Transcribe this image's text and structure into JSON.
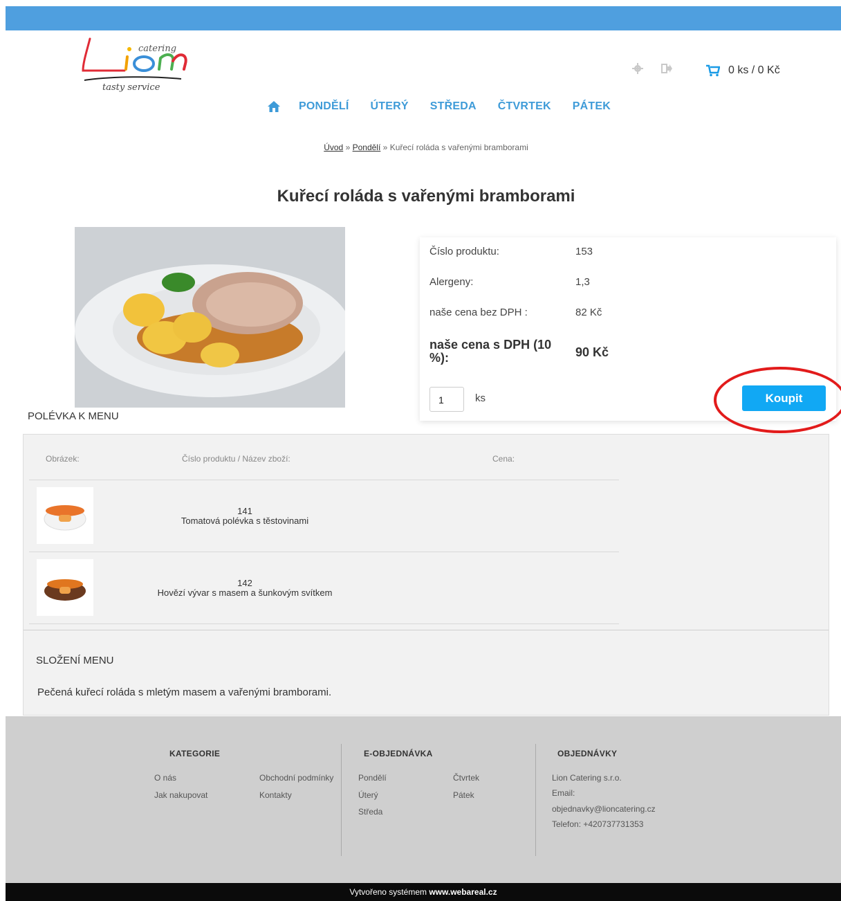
{
  "logo": {
    "small": "catering",
    "main": "Lion",
    "tagline": "tasty service"
  },
  "header": {
    "icons": [
      "gear-icon",
      "logout-icon",
      "cart-icon"
    ],
    "cart": "0 ks / 0 Kč"
  },
  "nav": {
    "items": [
      "PONDĚLÍ",
      "ÚTERÝ",
      "STŘEDA",
      "ČTVRTEK",
      "PÁTEK"
    ]
  },
  "breadcrumb": {
    "home": "Úvod",
    "sep": "»",
    "category": "Pondělí",
    "current": "Kuřecí roláda s vařenými bramborami"
  },
  "product": {
    "title": "Kuřecí roláda s vařenými bramborami",
    "rows": [
      {
        "label": "Číslo produktu:",
        "value": "153"
      },
      {
        "label": "Alergeny:",
        "value": "1,3"
      },
      {
        "label": "naše cena bez DPH :",
        "value": "82 Kč"
      }
    ],
    "price_label": "naše cena s DPH (10 %):",
    "price_value": "90 Kč",
    "qty": "1",
    "qty_unit": "ks",
    "buy_label": "Koupit"
  },
  "soups": {
    "heading": "POLÉVKA K MENU",
    "columns": [
      "Obrázek:",
      "Číslo produktu / Název zboží:",
      "Cena:"
    ],
    "items": [
      {
        "number": "141",
        "name": "Tomatová polévka s těstovinami"
      },
      {
        "number": "142",
        "name": "Hovězí vývar s masem a šunkovým svítkem"
      }
    ]
  },
  "composition": {
    "heading": "SLOŽENÍ MENU",
    "text": "Pečená kuřecí roláda s mletým masem a vařenými bramborami."
  },
  "footer": {
    "col1": {
      "title": "KATEGORIE",
      "items": [
        "O nás",
        "Jak nakupovat",
        "Obchodní podmínky",
        "Kontakty"
      ]
    },
    "col2": {
      "title": "E-OBJEDNÁVKA",
      "items": [
        "Pondělí",
        "Úterý",
        "Středa",
        "Čtvrtek",
        "Pátek"
      ]
    },
    "col3": {
      "title": "OBJEDNÁVKY",
      "items": [
        "Lion Catering s.r.o.",
        "Email:",
        "objednavky@lioncatering.cz",
        "Telefon: +420737731353"
      ]
    }
  },
  "bottom": {
    "prefix": "Vytvořeno systémem",
    "brand": "www.webareal.cz"
  },
  "colors": {
    "topbar": "#4f9fdf",
    "nav": "#3e9bd8",
    "buy": "#11a8f4",
    "highlight": "#e21b1b"
  }
}
